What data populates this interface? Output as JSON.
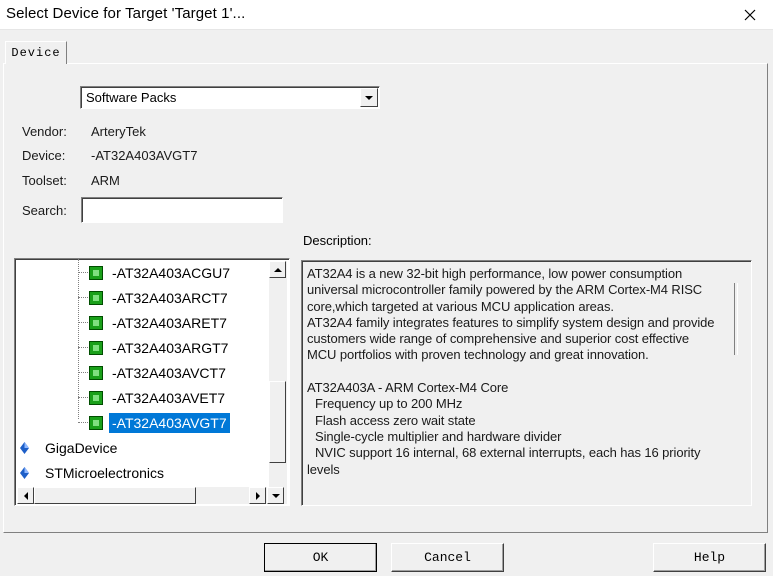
{
  "window": {
    "title": "Select Device for Target 'Target 1'..."
  },
  "tabs": [
    {
      "label": "Device"
    }
  ],
  "source_select": {
    "value": "Software Packs"
  },
  "info": {
    "vendor_label": "Vendor:",
    "vendor_value": "ArteryTek",
    "device_label": "Device:",
    "device_value": "-AT32A403AVGT7",
    "toolset_label": "Toolset:",
    "toolset_value": "ARM",
    "search_label": "Search:",
    "search_value": ""
  },
  "tree": {
    "devices": [
      {
        "label": "-AT32A403ACGU7"
      },
      {
        "label": "-AT32A403ARCT7"
      },
      {
        "label": "-AT32A403ARET7"
      },
      {
        "label": "-AT32A403ARGT7"
      },
      {
        "label": "-AT32A403AVCT7"
      },
      {
        "label": "-AT32A403AVET7"
      },
      {
        "label": "-AT32A403AVGT7",
        "selected": true
      }
    ],
    "vendors": [
      {
        "label": "GigaDevice"
      },
      {
        "label": "STMicroelectronics"
      }
    ]
  },
  "description": {
    "label": "Description:",
    "lines": [
      "AT32A4 is a new 32-bit high performance, low power consumption",
      "universal microcontroller family powered by the ARM Cortex-M4 RISC",
      "core,which targeted at various MCU application areas.",
      "AT32A4 family integrates features to simplify system design and provide",
      "customers wide range of comprehensive and superior cost effective",
      "MCU portfolios with proven technology and great innovation.",
      "",
      "AT32A403A - ARM Cortex-M4 Core",
      "  Frequency up to 200 MHz",
      "  Flash access zero wait state",
      "  Single-cycle multiplier and hardware divider",
      "  NVIC support 16 internal, 68 external interrupts, each has 16 priority",
      "levels"
    ]
  },
  "buttons": {
    "ok": "OK",
    "cancel": "Cancel",
    "help": "Help"
  },
  "icons": {
    "chip": "chip-icon",
    "vendor": "vendor-diamond-icon",
    "close": "close-icon"
  },
  "colors": {
    "selection": "#0078d7",
    "chip": "#1aa01a",
    "vendor_gem": "#1e5fc8"
  }
}
